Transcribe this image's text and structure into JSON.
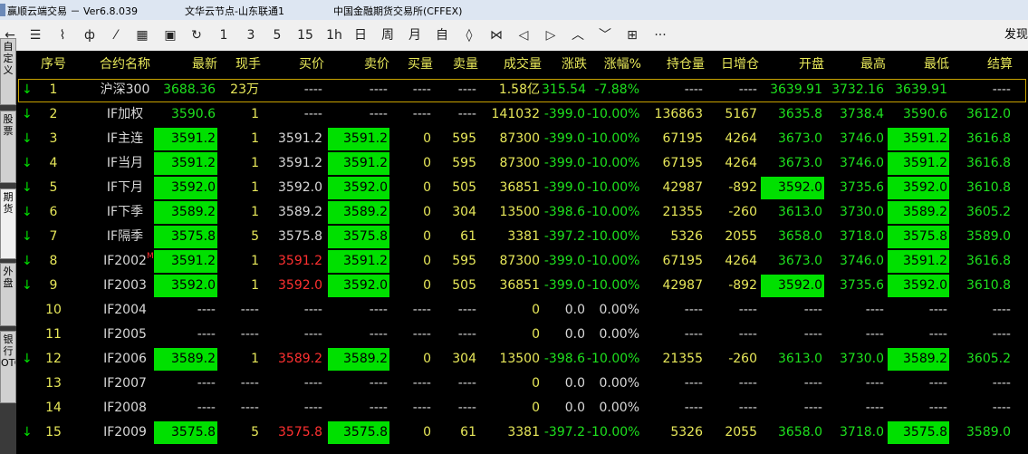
{
  "titlebar": {
    "app_title": "赢顺云端交易 － Ver6.8.039",
    "node": "文华云节点-山东联通1",
    "exchange": "中国金融期货交易所(CFFEX)"
  },
  "toolbar": {
    "buttons": [
      {
        "name": "back-icon",
        "glyph": "←"
      },
      {
        "name": "quote-list-icon",
        "glyph": "☰"
      },
      {
        "name": "line-chart-icon",
        "glyph": "⌇"
      },
      {
        "name": "candlestick-icon",
        "glyph": "ф"
      },
      {
        "name": "formula-icon",
        "glyph": "⁄"
      },
      {
        "name": "f10-icon",
        "glyph": "▦"
      },
      {
        "name": "save-icon",
        "glyph": "▣"
      },
      {
        "name": "refresh-icon",
        "glyph": "↻"
      },
      {
        "name": "period-1min",
        "label": "1"
      },
      {
        "name": "period-3min",
        "label": "3"
      },
      {
        "name": "period-5min",
        "label": "5"
      },
      {
        "name": "period-15min",
        "label": "15"
      },
      {
        "name": "period-1hour",
        "label": "1h"
      },
      {
        "name": "period-day",
        "label": "日"
      },
      {
        "name": "period-week",
        "label": "周"
      },
      {
        "name": "period-month",
        "label": "月"
      },
      {
        "name": "period-custom",
        "label": "自"
      },
      {
        "name": "zoom-in-icon",
        "glyph": "◊"
      },
      {
        "name": "zoom-out-icon",
        "glyph": "⋈"
      },
      {
        "name": "arrow-left-icon",
        "glyph": "◁"
      },
      {
        "name": "arrow-right-icon",
        "glyph": "▷"
      },
      {
        "name": "arrow-up-icon",
        "glyph": "︿"
      },
      {
        "name": "arrow-down-icon",
        "glyph": "﹀"
      },
      {
        "name": "layout-icon",
        "glyph": "⊞"
      },
      {
        "name": "more-icon",
        "glyph": "···"
      }
    ],
    "right_label": "发现"
  },
  "sidebar": {
    "tabs": [
      "自定义",
      "股票",
      "期货",
      "外盘",
      "银行OTC"
    ]
  },
  "headers": [
    "序号",
    "合约名称",
    "最新",
    "现手",
    "买价",
    "卖价",
    "买量",
    "卖量",
    "成交量",
    "涨跌",
    "涨幅%",
    "持仓量",
    "日增仓",
    "开盘",
    "最高",
    "最低",
    "结算"
  ],
  "rows": [
    {
      "arrow": "↓",
      "no": "1",
      "name": "沪深300",
      "last": "3688.36",
      "hand": "23万",
      "bid": "----",
      "ask": "----",
      "bidv": "----",
      "askv": "----",
      "vol": "1.58亿",
      "chg": "315.54",
      "pct": "-7.88%",
      "oi": "----",
      "doi": "----",
      "open": "3639.91",
      "high": "3732.16",
      "low": "3639.91",
      "settle": "----"
    },
    {
      "arrow": "↓",
      "no": "2",
      "name": "IF加权",
      "last": "3590.6",
      "hand": "1",
      "bid": "----",
      "ask": "----",
      "bidv": "----",
      "askv": "----",
      "vol": "141032",
      "chg": "-399.0",
      "pct": "-10.00%",
      "oi": "136863",
      "doi": "5167",
      "open": "3635.8",
      "high": "3738.4",
      "low": "3590.6",
      "settle": "3612.0"
    },
    {
      "arrow": "↓",
      "no": "3",
      "name": "IF主连",
      "last": "3591.2",
      "hand": "1",
      "bid": "3591.2",
      "ask": "3591.2",
      "bidv": "0",
      "askv": "595",
      "vol": "87300",
      "chg": "-399.0",
      "pct": "-10.00%",
      "oi": "67195",
      "doi": "4264",
      "open": "3673.0",
      "high": "3746.0",
      "low": "3591.2",
      "settle": "3616.8"
    },
    {
      "arrow": "↓",
      "no": "4",
      "name": "IF当月",
      "last": "3591.2",
      "hand": "1",
      "bid": "3591.2",
      "ask": "3591.2",
      "bidv": "0",
      "askv": "595",
      "vol": "87300",
      "chg": "-399.0",
      "pct": "-10.00%",
      "oi": "67195",
      "doi": "4264",
      "open": "3673.0",
      "high": "3746.0",
      "low": "3591.2",
      "settle": "3616.8"
    },
    {
      "arrow": "↓",
      "no": "5",
      "name": "IF下月",
      "last": "3592.0",
      "hand": "1",
      "bid": "3592.0",
      "ask": "3592.0",
      "bidv": "0",
      "askv": "505",
      "vol": "36851",
      "chg": "-399.0",
      "pct": "-10.00%",
      "oi": "42987",
      "doi": "-892",
      "open": "3592.0",
      "high": "3735.6",
      "low": "3592.0",
      "settle": "3610.8"
    },
    {
      "arrow": "↓",
      "no": "6",
      "name": "IF下季",
      "last": "3589.2",
      "hand": "1",
      "bid": "3589.2",
      "ask": "3589.2",
      "bidv": "0",
      "askv": "304",
      "vol": "13500",
      "chg": "-398.6",
      "pct": "-10.00%",
      "oi": "21355",
      "doi": "-260",
      "open": "3613.0",
      "high": "3730.0",
      "low": "3589.2",
      "settle": "3605.2"
    },
    {
      "arrow": "↓",
      "no": "7",
      "name": "IF隔季",
      "last": "3575.8",
      "hand": "5",
      "bid": "3575.8",
      "ask": "3575.8",
      "bidv": "0",
      "askv": "61",
      "vol": "3381",
      "chg": "-397.2",
      "pct": "-10.00%",
      "oi": "5326",
      "doi": "2055",
      "open": "3658.0",
      "high": "3718.0",
      "low": "3575.8",
      "settle": "3589.0"
    },
    {
      "arrow": "↓",
      "no": "8",
      "name": "IF2002",
      "mark": "M",
      "last": "3591.2",
      "hand": "1",
      "bid": "3591.2",
      "ask": "3591.2",
      "bidv": "0",
      "askv": "595",
      "vol": "87300",
      "chg": "-399.0",
      "pct": "-10.00%",
      "oi": "67195",
      "doi": "4264",
      "open": "3673.0",
      "high": "3746.0",
      "low": "3591.2",
      "settle": "3616.8"
    },
    {
      "arrow": "↓",
      "no": "9",
      "name": "IF2003",
      "last": "3592.0",
      "hand": "1",
      "bid": "3592.0",
      "ask": "3592.0",
      "bidv": "0",
      "askv": "505",
      "vol": "36851",
      "chg": "-399.0",
      "pct": "-10.00%",
      "oi": "42987",
      "doi": "-892",
      "open": "3592.0",
      "high": "3735.6",
      "low": "3592.0",
      "settle": "3610.8"
    },
    {
      "arrow": "",
      "no": "10",
      "name": "IF2004",
      "last": "----",
      "hand": "----",
      "bid": "----",
      "ask": "----",
      "bidv": "----",
      "askv": "----",
      "vol": "0",
      "chg": "0.0",
      "pct": "0.00%",
      "oi": "----",
      "doi": "----",
      "open": "----",
      "high": "----",
      "low": "----",
      "settle": "----"
    },
    {
      "arrow": "",
      "no": "11",
      "name": "IF2005",
      "last": "----",
      "hand": "----",
      "bid": "----",
      "ask": "----",
      "bidv": "----",
      "askv": "----",
      "vol": "0",
      "chg": "0.0",
      "pct": "0.00%",
      "oi": "----",
      "doi": "----",
      "open": "----",
      "high": "----",
      "low": "----",
      "settle": "----"
    },
    {
      "arrow": "↓",
      "no": "12",
      "name": "IF2006",
      "last": "3589.2",
      "hand": "1",
      "bid": "3589.2",
      "ask": "3589.2",
      "bidv": "0",
      "askv": "304",
      "vol": "13500",
      "chg": "-398.6",
      "pct": "-10.00%",
      "oi": "21355",
      "doi": "-260",
      "open": "3613.0",
      "high": "3730.0",
      "low": "3589.2",
      "settle": "3605.2"
    },
    {
      "arrow": "",
      "no": "13",
      "name": "IF2007",
      "last": "----",
      "hand": "----",
      "bid": "----",
      "ask": "----",
      "bidv": "----",
      "askv": "----",
      "vol": "0",
      "chg": "0.0",
      "pct": "0.00%",
      "oi": "----",
      "doi": "----",
      "open": "----",
      "high": "----",
      "low": "----",
      "settle": "----"
    },
    {
      "arrow": "",
      "no": "14",
      "name": "IF2008",
      "last": "----",
      "hand": "----",
      "bid": "----",
      "ask": "----",
      "bidv": "----",
      "askv": "----",
      "vol": "0",
      "chg": "0.0",
      "pct": "0.00%",
      "oi": "----",
      "doi": "----",
      "open": "----",
      "high": "----",
      "low": "----",
      "settle": "----"
    },
    {
      "arrow": "↓",
      "no": "15",
      "name": "IF2009",
      "last": "3575.8",
      "hand": "5",
      "bid": "3575.8",
      "ask": "3575.8",
      "bidv": "0",
      "askv": "61",
      "vol": "3381",
      "chg": "-397.2",
      "pct": "-10.00%",
      "oi": "5326",
      "doi": "2055",
      "open": "3658.0",
      "high": "3718.0",
      "low": "3575.8",
      "settle": "3589.0"
    }
  ]
}
